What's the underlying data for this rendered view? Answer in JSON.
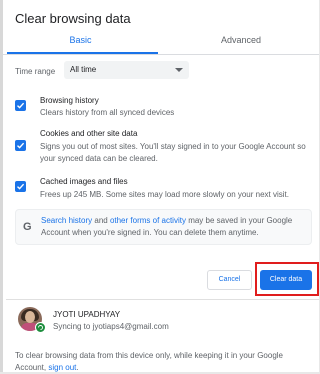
{
  "dialog": {
    "title": "Clear browsing data"
  },
  "tabs": [
    {
      "label": "Basic",
      "active": true
    },
    {
      "label": "Advanced",
      "active": false
    }
  ],
  "time_range": {
    "label": "Time range",
    "value": "All time"
  },
  "options": [
    {
      "title": "Browsing history",
      "description": "Clears history from all synced devices",
      "checked": true
    },
    {
      "title": "Cookies and other site data",
      "description": "Signs you out of most sites. You'll stay signed in to your Google Account so your synced data can be cleared.",
      "checked": true
    },
    {
      "title": "Cached images and files",
      "description": "Frees up 245 MB. Some sites may load more slowly on your next visit.",
      "checked": true
    }
  ],
  "info": {
    "icon": "google-g-icon",
    "link1": "Search history",
    "and": " and ",
    "link2": "other forms of activity",
    "rest": " may be saved in your Google Account when you're signed in. You can delete them anytime."
  },
  "buttons": {
    "cancel": "Cancel",
    "clear": "Clear data",
    "highlight_color": "#e01d1d"
  },
  "account": {
    "name": "JYOTI UPADHYAY",
    "sync_text": "Syncing to jyotiaps4@gmail.com"
  },
  "footer": {
    "text": "To clear browsing data from this device only, while keeping it in your Google Account, ",
    "link": "sign out",
    "end": "."
  },
  "colors": {
    "accent": "#1a73e8",
    "sync_green": "#1e8e3e"
  }
}
